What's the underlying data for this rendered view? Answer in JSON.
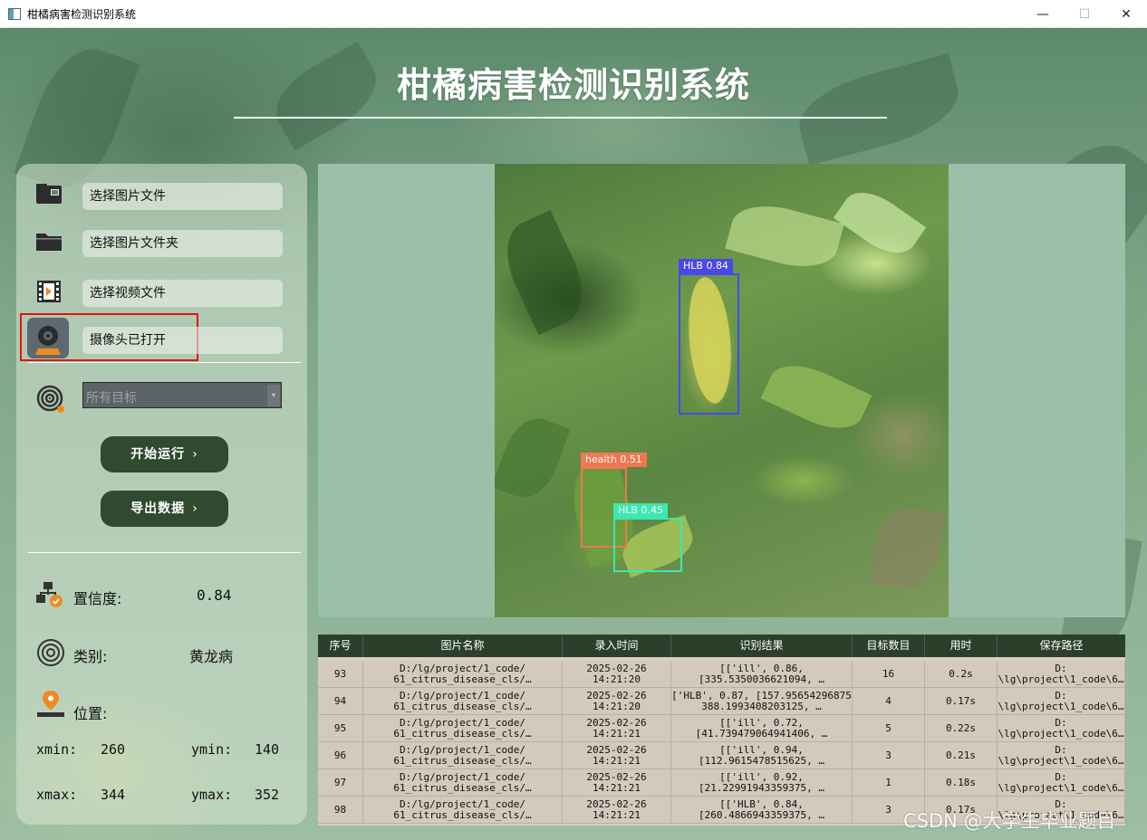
{
  "window": {
    "title": "柑橘病害检测识别系统",
    "minimize_glyph": "—",
    "maximize_glyph": "☐",
    "close_glyph": "✕"
  },
  "app_title": "柑橘病害检测识别系统",
  "sidebar": {
    "items": [
      {
        "label": "选择图片文件",
        "icon": "image-file-icon"
      },
      {
        "label": "选择图片文件夹",
        "icon": "folder-icon"
      },
      {
        "label": "选择视频文件",
        "icon": "video-file-icon"
      },
      {
        "label": "摄像头已打开",
        "icon": "camera-icon"
      }
    ],
    "target_select": {
      "value": "所有目标",
      "icon": "target-icon",
      "arrow": "▾"
    },
    "buttons": {
      "run": "开始运行",
      "export": "导出数据",
      "chevron": "›"
    },
    "info": {
      "confidence_label": "置信度:",
      "confidence_value": "0.84",
      "class_label": "类别:",
      "class_value": "黄龙病",
      "position_label": "位置:",
      "xmin_label": "xmin:",
      "xmin_value": "260",
      "ymin_label": "ymin:",
      "ymin_value": "140",
      "xmax_label": "xmax:",
      "xmax_value": "344",
      "ymax_label": "ymax:",
      "ymax_value": "352"
    }
  },
  "detections": [
    {
      "label": "HLB 0.84",
      "color": "#4a48e8"
    },
    {
      "label": "health 0.51",
      "color": "#f07850"
    },
    {
      "label": "HLB 0.45",
      "color": "#3ce8b0"
    }
  ],
  "table": {
    "headers": [
      "序号",
      "图片名称",
      "录入时间",
      "识别结果",
      "目标数目",
      "用时",
      "保存路径"
    ],
    "rows": [
      [
        "93",
        "D:/lg/project/1_code/\n61_citrus_disease_cls/…",
        "2025-02-26\n14:21:20",
        "[['ill', 0.86,\n[335.5350036621094, …",
        "16",
        "0.2s",
        "D:\n\\lg\\project\\1_code\\6…"
      ],
      [
        "94",
        "D:/lg/project/1_code/\n61_citrus_disease_cls/…",
        "2025-02-26\n14:21:20",
        "[['HLB', 0.87, [157.95654296875,\n388.1993408203125, …",
        "4",
        "0.17s",
        "D:\n\\lg\\project\\1_code\\6…"
      ],
      [
        "95",
        "D:/lg/project/1_code/\n61_citrus_disease_cls/…",
        "2025-02-26\n14:21:21",
        "[['ill', 0.72,\n[41.739479064941406, …",
        "5",
        "0.22s",
        "D:\n\\lg\\project\\1_code\\6…"
      ],
      [
        "96",
        "D:/lg/project/1_code/\n61_citrus_disease_cls/…",
        "2025-02-26\n14:21:21",
        "[['ill', 0.94,\n[112.9615478515625, …",
        "3",
        "0.21s",
        "D:\n\\lg\\project\\1_code\\6…"
      ],
      [
        "97",
        "D:/lg/project/1_code/\n61_citrus_disease_cls/…",
        "2025-02-26\n14:21:21",
        "[['ill', 0.92,\n[21.22991943359375, …",
        "1",
        "0.18s",
        "D:\n\\lg\\project\\1_code\\6…"
      ],
      [
        "98",
        "D:/lg/project/1_code/\n61_citrus_disease_cls/…",
        "2025-02-26\n14:21:21",
        "[['HLB', 0.84,\n[260.4866943359375, …",
        "3",
        "0.17s",
        "D:\n\\lg\\project\\1_code\\6…"
      ]
    ]
  },
  "watermark": "CSDN @大学生毕业题目"
}
